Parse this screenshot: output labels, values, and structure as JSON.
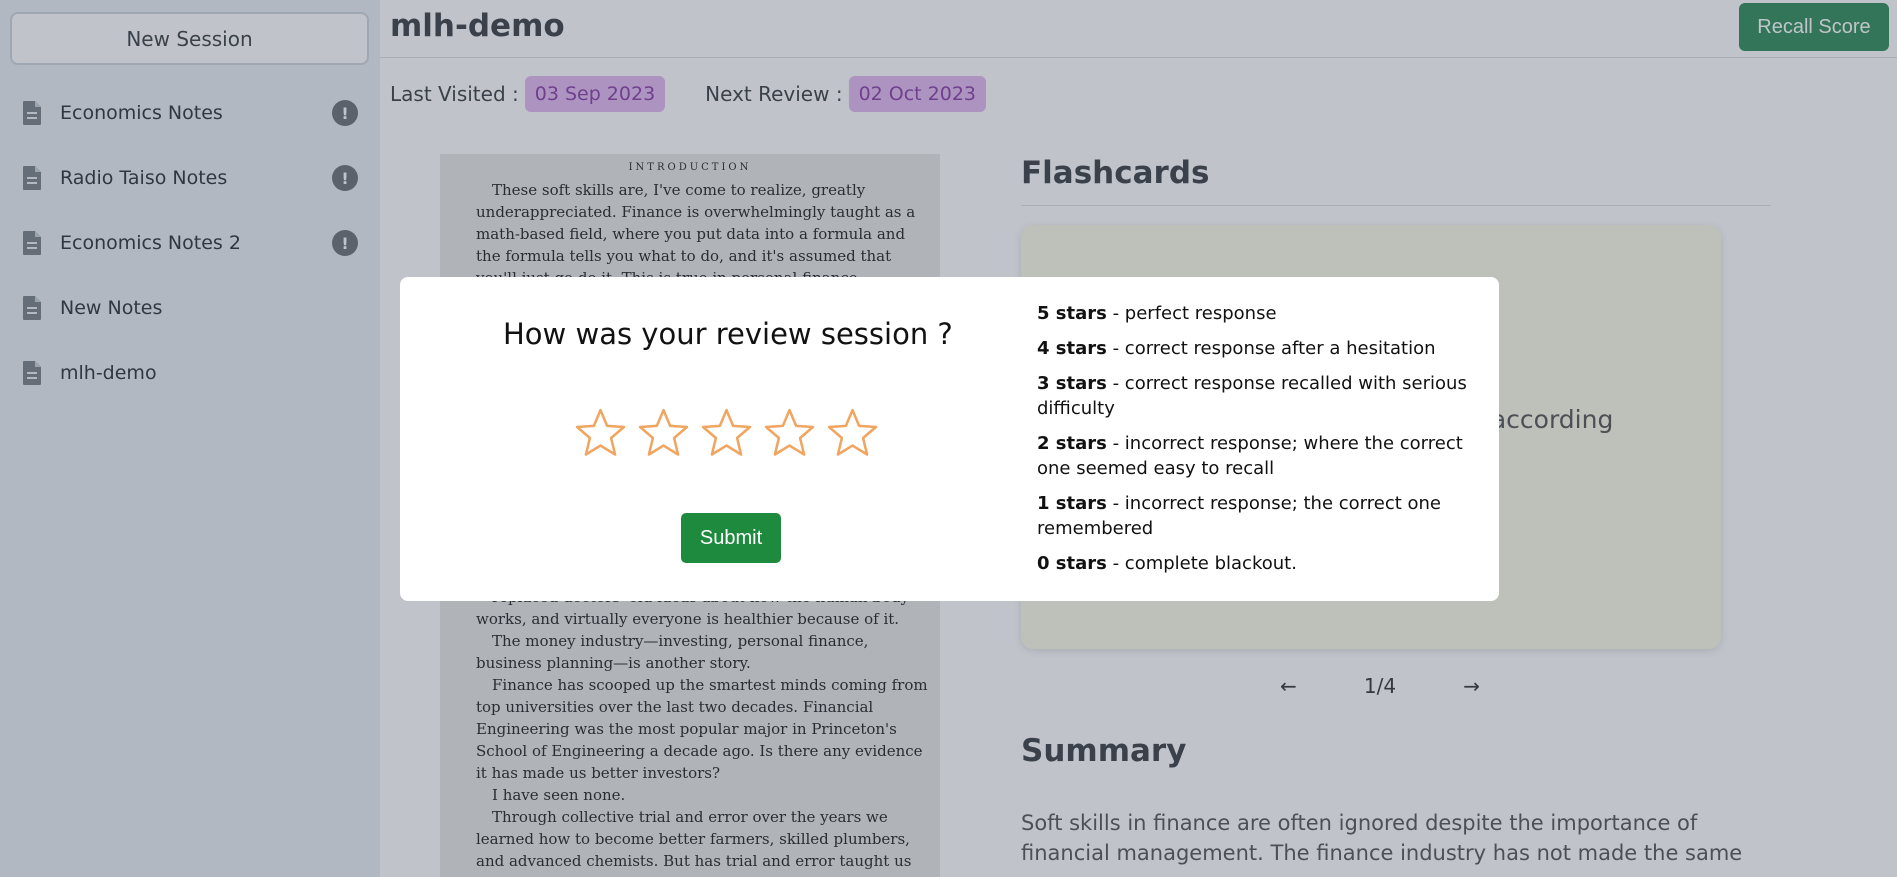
{
  "sidebar": {
    "new_session_label": "New Session",
    "items": [
      {
        "label": "Economics Notes",
        "icon": "document-icon",
        "alert": "!"
      },
      {
        "label": "Radio Taiso Notes",
        "icon": "document-icon",
        "alert": "!"
      },
      {
        "label": "Economics Notes 2",
        "icon": "document-icon",
        "alert": "!"
      },
      {
        "label": "New Notes",
        "icon": "document-icon"
      },
      {
        "label": "mlh-demo",
        "icon": "document-icon"
      }
    ]
  },
  "header": {
    "title": "mlh-demo",
    "recall_label": "Recall Score",
    "last_visited_label": "Last Visited :",
    "last_visited": "03 Sep 2023",
    "next_review_label": "Next Review :",
    "next_review": "02 Oct 2023"
  },
  "scan": {
    "heading": "INTRODUCTION",
    "top_text": "These soft skills are, I've come to realize, greatly underappreciated. Finance is overwhelmingly taught as a math-based field, where you put data into a formula and the formula tells you what to do, and it's assumed that you'll just go do it. This is true in personal finance,",
    "bottom_lines": [
      "replaced doctors' old ideas about how the human body works, and virtually everyone is healthier because of it.",
      "The money industry—investing, personal finance, business planning—is another story.",
      "Finance has scooped up the smartest minds coming from top universities over the last two decades. Financial Engineering was the most popular major in Princeton's School of Engineering a decade ago. Is there any evidence it has made us better investors?",
      "I have seen none.",
      "Through collective trial and error over the years we learned how to become better farmers, skilled plumbers, and advanced chemists. But has trial and error taught us to become better with"
    ]
  },
  "flashcards": {
    "title": "Flashcards",
    "visible_text": "tion according",
    "prev": "←",
    "next": "→",
    "counter": "1/4"
  },
  "summary": {
    "title": "Summary",
    "text": "Soft skills in finance are often ignored despite the importance of financial management. The finance industry has not made the same"
  },
  "modal": {
    "question": "How was your review session ?",
    "rating": 0,
    "max_rating": 5,
    "submit_label": "Submit",
    "legend": [
      {
        "stars": "5 stars",
        "desc": " - perfect response"
      },
      {
        "stars": "4 stars",
        "desc": " - correct response after a hesitation"
      },
      {
        "stars": "3 stars",
        "desc": " - correct response recalled with serious difficulty"
      },
      {
        "stars": "2 stars",
        "desc": " - incorrect response; where the correct one seemed easy to recall"
      },
      {
        "stars": "1 stars",
        "desc": " - incorrect response; the correct one remembered"
      },
      {
        "stars": "0 stars",
        "desc": " - complete blackout."
      }
    ]
  },
  "colors": {
    "sidebar_bg": "#e9edf2",
    "badge_bg": "#e3b8f1",
    "badge_text": "#8a3ca7",
    "recall_button": "#2e8b57",
    "submit_button": "#1e8a3e",
    "star_outline": "#f0a560",
    "flashcard_bg": "#fcfbe6"
  }
}
